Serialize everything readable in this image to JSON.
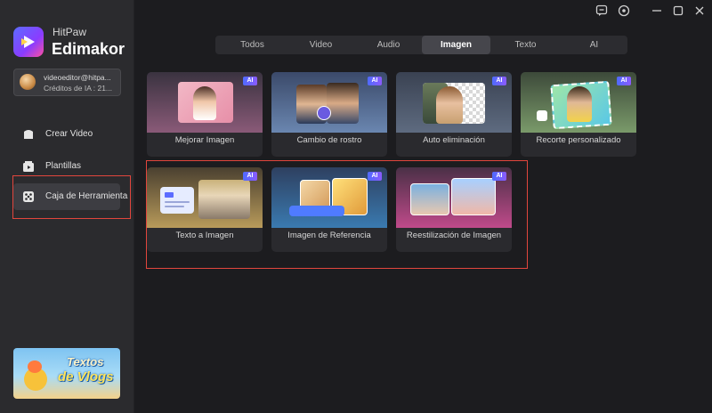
{
  "app": {
    "brand_top": "HitPaw",
    "brand_main": "Edimakor"
  },
  "account": {
    "email": "videoeditor@hitpa...",
    "credits": "Créditos de IA : 21..."
  },
  "nav": [
    {
      "label": "Crear Video",
      "icon": "create-video-icon"
    },
    {
      "label": "Plantillas",
      "icon": "templates-icon"
    },
    {
      "label": "Caja de Herramienta",
      "icon": "toolbox-icon",
      "active": true
    }
  ],
  "promo": {
    "line1": "Textos",
    "line2": "de Vlogs"
  },
  "tabs": [
    {
      "label": "Todos"
    },
    {
      "label": "Video"
    },
    {
      "label": "Audio"
    },
    {
      "label": "Imagen",
      "active": true
    },
    {
      "label": "Texto"
    },
    {
      "label": "AI"
    }
  ],
  "badge": "AI",
  "tools": [
    {
      "label": "Mejorar Imagen",
      "badge": "AI"
    },
    {
      "label": "Cambio de rostro",
      "badge": "AI"
    },
    {
      "label": "Auto eliminación",
      "badge": "AI"
    },
    {
      "label": "Recorte personalizado",
      "badge": "AI"
    },
    {
      "label": "Texto a Imagen",
      "badge": "AI"
    },
    {
      "label": "Imagen de Referencia",
      "badge": "AI"
    },
    {
      "label": "Reestilización de Imagen",
      "badge": "AI"
    }
  ],
  "colors": {
    "accent": "#5c6cff",
    "highlight": "#e2463d",
    "background": "#1c1c1f",
    "sidebar": "#2b2b2e"
  }
}
